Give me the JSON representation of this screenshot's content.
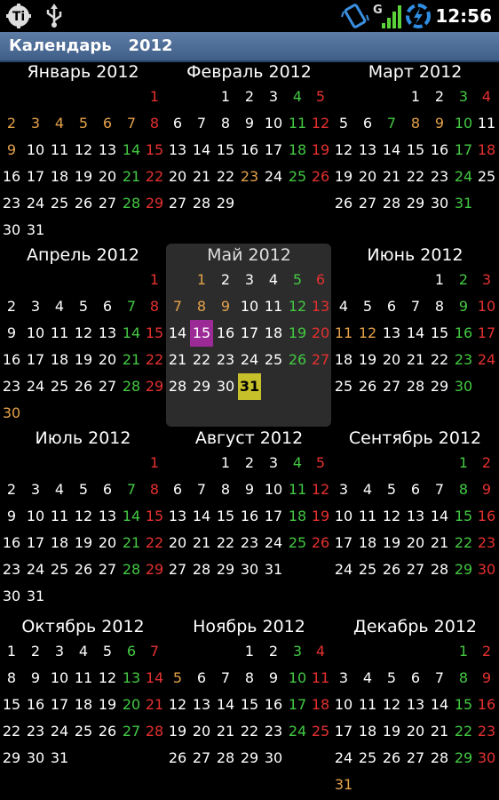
{
  "statusbar": {
    "time": "12:56",
    "network_label": "G",
    "icons": [
      "tasker-icon",
      "usb-icon",
      "vibrate-icon",
      "signal-icon",
      "sync-icon"
    ]
  },
  "titlebar": {
    "title": "Календарь   2012"
  },
  "colors": {
    "white": "#ffffff",
    "weekend_red": "#e53030",
    "holiday_green": "#43c943",
    "workday_orange": "#e3a24a",
    "today_bg": "#c6c02a",
    "special_bg": "#9c2a96",
    "highlight_bg": "#2c2c2c",
    "titlebar_bg": "#4f6f98"
  },
  "months": [
    {
      "name": "Январь 2012",
      "start": 6,
      "days": 31,
      "colors": {
        "1": "red",
        "2": "orange",
        "3": "orange",
        "4": "orange",
        "5": "orange",
        "6": "orange",
        "7": "orange",
        "8": "red",
        "9": "orange",
        "14": "green",
        "15": "red",
        "21": "green",
        "22": "red",
        "28": "green",
        "29": "red"
      }
    },
    {
      "name": "Февраль 2012",
      "start": 2,
      "days": 29,
      "colors": {
        "4": "green",
        "5": "red",
        "11": "green",
        "12": "red",
        "18": "green",
        "19": "red",
        "23": "orange",
        "25": "green",
        "26": "red"
      }
    },
    {
      "name": "Март 2012",
      "start": 3,
      "days": 31,
      "colors": {
        "3": "green",
        "4": "red",
        "7": "green",
        "8": "orange",
        "9": "orange",
        "10": "green",
        "17": "green",
        "18": "red",
        "24": "green",
        "31": "green"
      }
    },
    {
      "name": "Апрель 2012",
      "start": 6,
      "days": 30,
      "colors": {
        "1": "red",
        "7": "green",
        "8": "red",
        "14": "green",
        "15": "red",
        "21": "green",
        "22": "red",
        "28": "green",
        "29": "red",
        "30": "orange"
      }
    },
    {
      "name": "Май 2012",
      "start": 1,
      "days": 31,
      "highlight": true,
      "today": 31,
      "special": 15,
      "colors": {
        "1": "orange",
        "5": "green",
        "6": "red",
        "7": "orange",
        "8": "orange",
        "9": "orange",
        "12": "green",
        "13": "red",
        "19": "green",
        "20": "red",
        "26": "green",
        "27": "red"
      }
    },
    {
      "name": "Июнь 2012",
      "start": 4,
      "days": 30,
      "colors": {
        "2": "green",
        "3": "red",
        "9": "green",
        "10": "red",
        "11": "orange",
        "12": "orange",
        "16": "green",
        "17": "red",
        "23": "green",
        "24": "red",
        "30": "green"
      }
    },
    {
      "name": "Июль 2012",
      "start": 6,
      "days": 31,
      "colors": {
        "1": "red",
        "7": "green",
        "8": "red",
        "14": "green",
        "15": "red",
        "21": "green",
        "22": "red",
        "28": "green",
        "29": "red"
      }
    },
    {
      "name": "Август 2012",
      "start": 2,
      "days": 31,
      "colors": {
        "4": "green",
        "5": "red",
        "11": "green",
        "12": "red",
        "18": "green",
        "19": "red",
        "25": "green",
        "26": "red"
      }
    },
    {
      "name": "Сентябрь 2012",
      "start": 5,
      "days": 30,
      "colors": {
        "1": "green",
        "2": "red",
        "8": "green",
        "9": "red",
        "15": "green",
        "16": "red",
        "22": "green",
        "23": "red",
        "29": "green",
        "30": "red"
      }
    },
    {
      "name": "Октябрь 2012",
      "start": 0,
      "days": 31,
      "colors": {
        "6": "green",
        "7": "red",
        "13": "green",
        "14": "red",
        "20": "green",
        "21": "red",
        "27": "green",
        "28": "red"
      }
    },
    {
      "name": "Ноябрь 2012",
      "start": 3,
      "days": 30,
      "colors": {
        "3": "green",
        "4": "red",
        "5": "orange",
        "10": "green",
        "11": "red",
        "17": "green",
        "18": "red",
        "24": "green",
        "25": "red"
      }
    },
    {
      "name": "Декабрь 2012",
      "start": 5,
      "days": 31,
      "colors": {
        "1": "green",
        "2": "red",
        "8": "green",
        "9": "red",
        "15": "green",
        "16": "red",
        "22": "green",
        "23": "red",
        "29": "green",
        "30": "red",
        "31": "orange"
      }
    }
  ]
}
